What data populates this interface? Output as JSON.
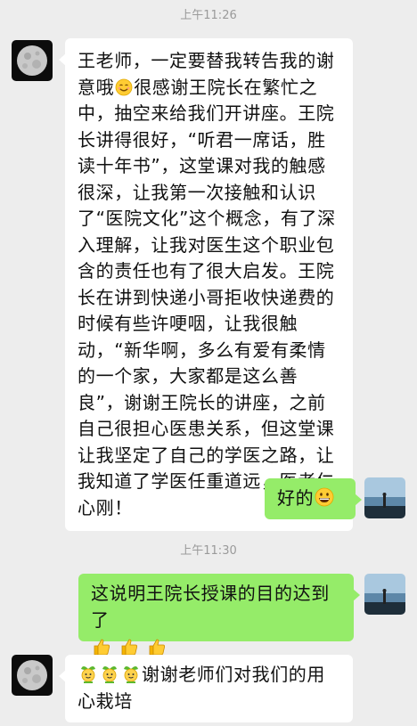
{
  "chat": {
    "time_1": "上午11:26",
    "time_2": "上午11:30",
    "msg1": {
      "part1": "王老师，一定要替我转告我的谢意哦",
      "emoji": "smiling-face",
      "part2": "很感谢王院长在繁忙之中，抽空来给我们开讲座。王院长讲得很好，“听君一席话，胜读十年书”，这堂课对我的触感很深，让我第一次接触和认识了“医院文化”这个概念，有了深入理解，让我对医生这个职业包含的责任也有了很大启发。王院长在讲到快递小哥拒收快递费的时候有些许哽咽，让我很触动，“新华啊，多么有爱有柔情的一个家，大家都是这么善良”，谢谢王院长的讲座，之前自己很担心医患关系，但这堂课让我坚定了自己的学医之路，让我知道了学医任重道远，医者仁心刚！"
    },
    "msg2": {
      "text": "好的",
      "emoji": "grinning-face"
    },
    "msg3": {
      "text": "这说明王院长授课的目的达到了",
      "emojis": [
        "thumbs-up",
        "thumbs-up",
        "thumbs-up"
      ]
    },
    "msg4": {
      "emojis": [
        "sprout-face",
        "sprout-face",
        "sprout-face"
      ],
      "text": "谢谢老师们对我们的用心栽培"
    }
  },
  "colors": {
    "background": "#ededed",
    "received_bubble": "#ffffff",
    "sent_bubble": "#95ec69",
    "timestamp": "#9a9a9a"
  }
}
